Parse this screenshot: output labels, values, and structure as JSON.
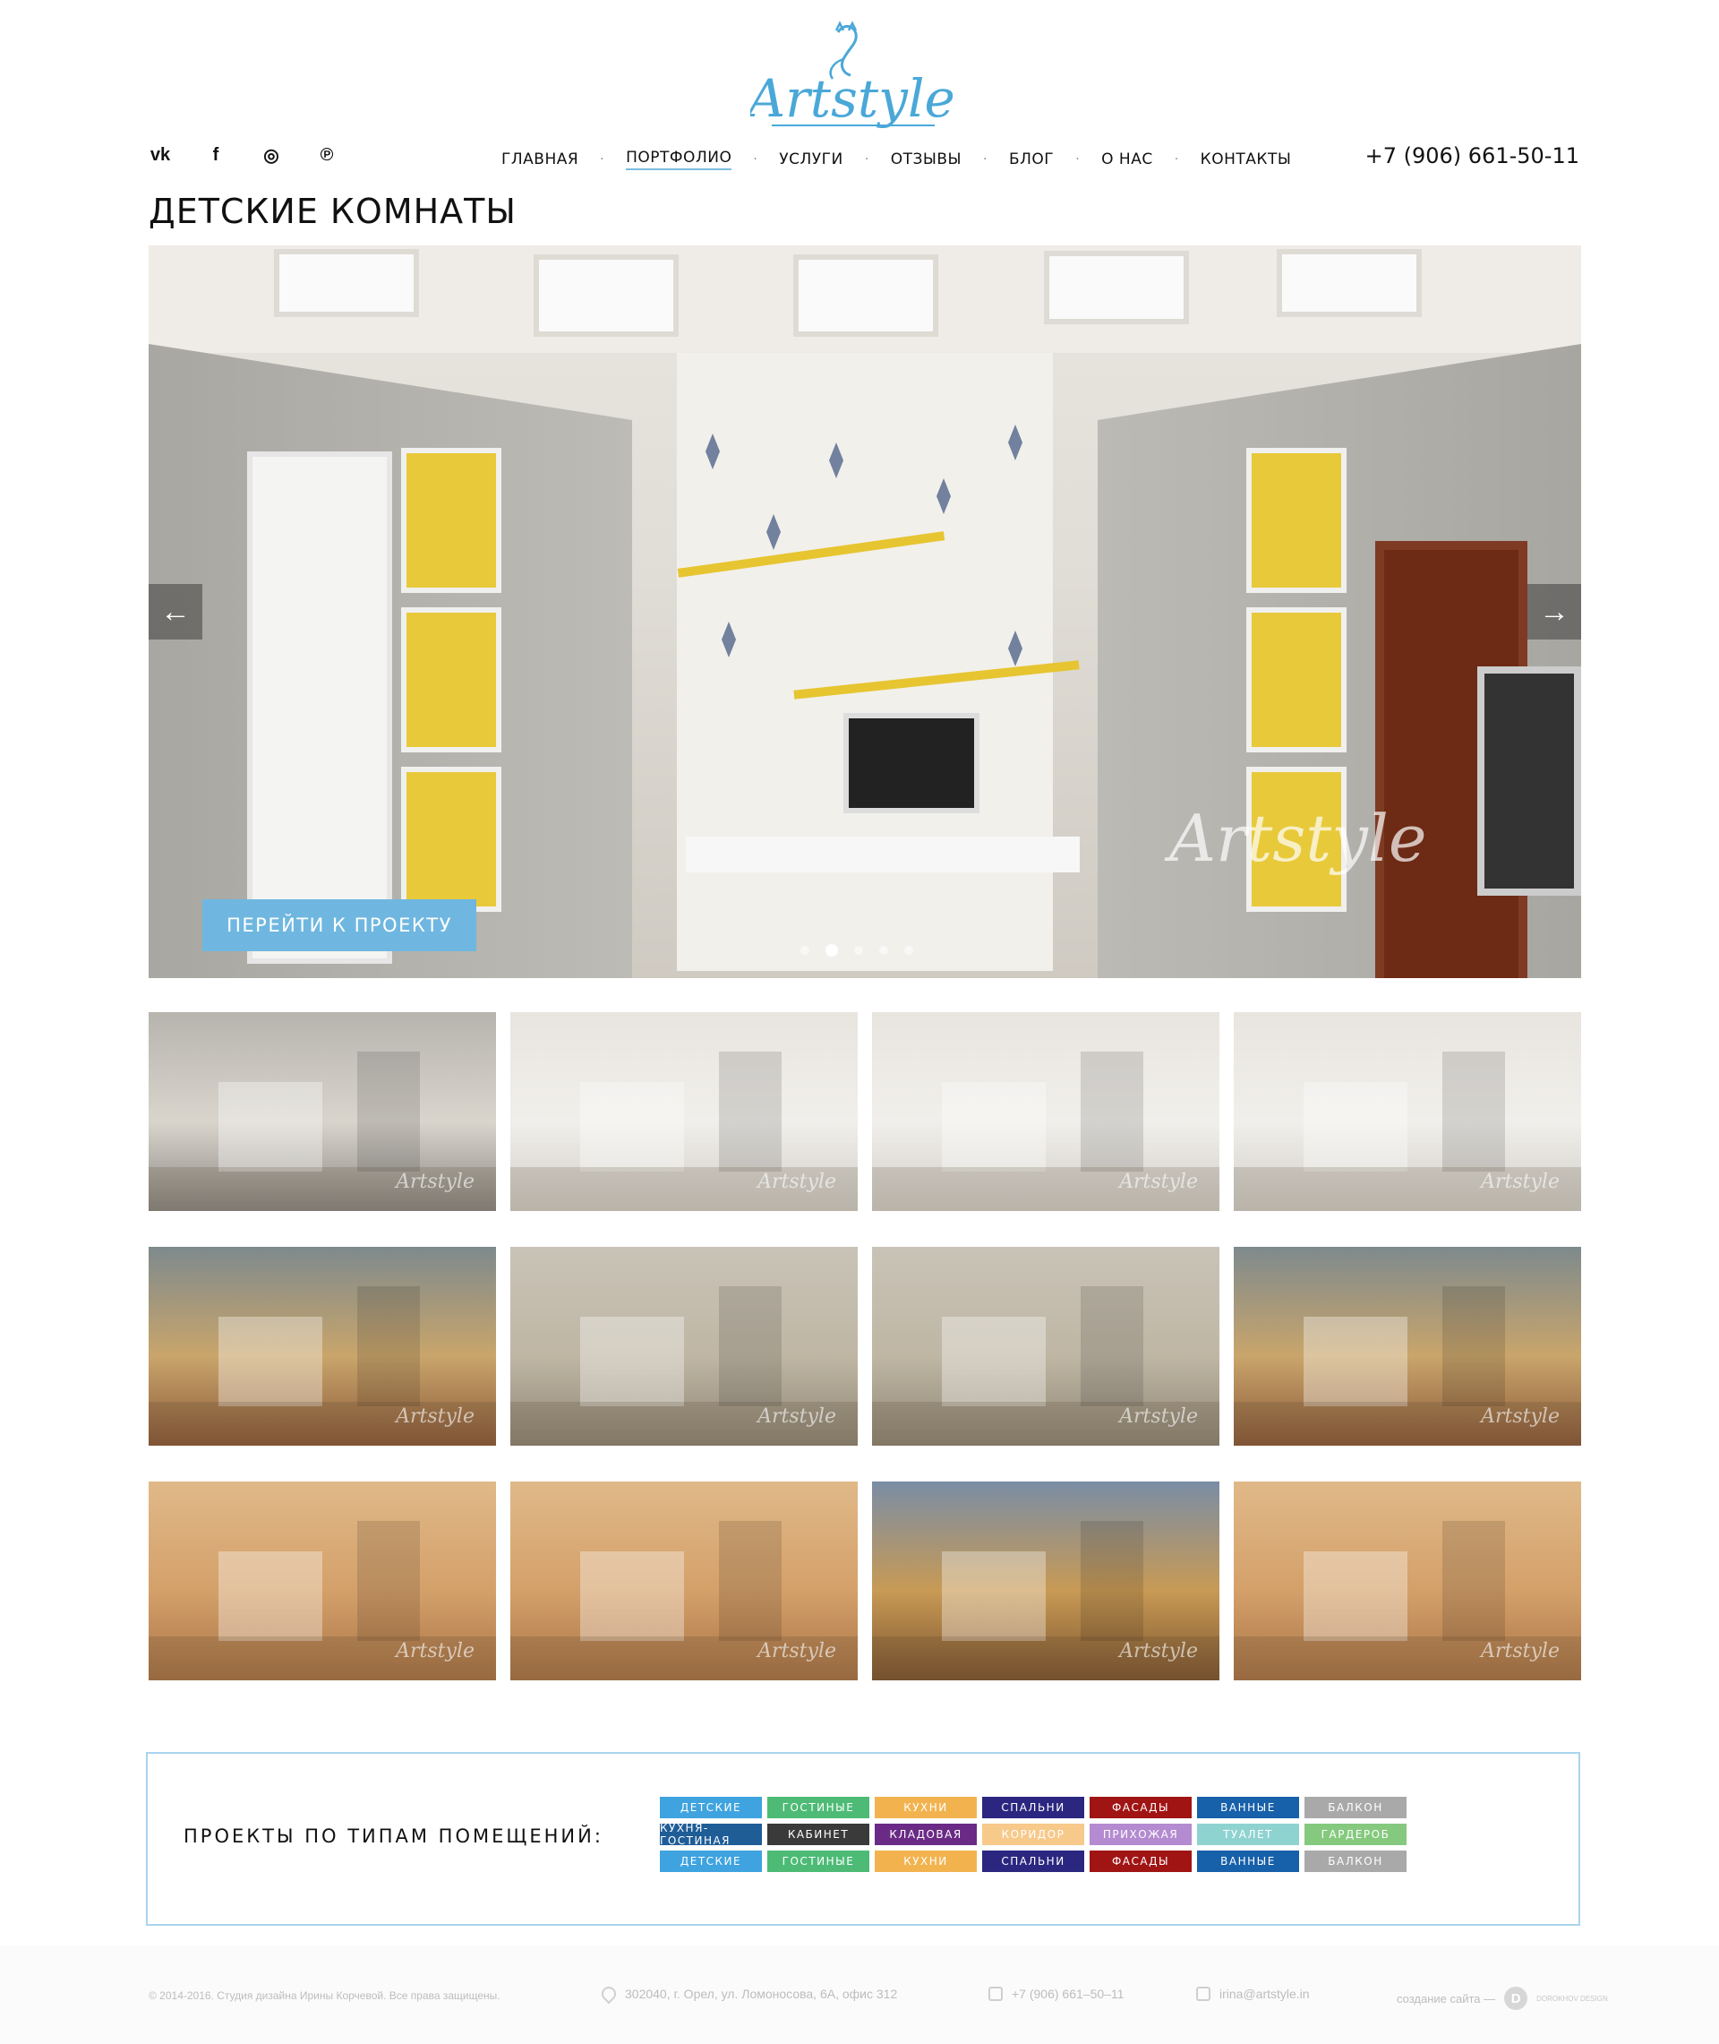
{
  "header": {
    "logo_text": "Artstyle",
    "social": [
      {
        "name": "vk",
        "glyph": "vk"
      },
      {
        "name": "facebook",
        "glyph": "f"
      },
      {
        "name": "instagram",
        "glyph": "◎"
      },
      {
        "name": "pinterest",
        "glyph": "℗"
      }
    ],
    "nav": [
      {
        "label": "Главная",
        "active": false
      },
      {
        "label": "Портфолио",
        "active": true
      },
      {
        "label": "Услуги",
        "active": false
      },
      {
        "label": "Отзывы",
        "active": false
      },
      {
        "label": "Блог",
        "active": false
      },
      {
        "label": "О нас",
        "active": false
      },
      {
        "label": "Контакты",
        "active": false
      }
    ],
    "nav_separator": "·",
    "phone": "+7 (906) 661-50-11"
  },
  "page_title": "ДЕТСКИЕ КОМНАТЫ",
  "slider": {
    "cta_label": "ПЕРЕЙТИ К ПРОЕКТУ",
    "watermark": "Artstyle",
    "prev_glyph": "←",
    "next_glyph": "→",
    "dots_total": 5,
    "active_dot": 2
  },
  "gallery": {
    "watermark": "Artstyle",
    "rows": 3,
    "cols": 4
  },
  "room_types": {
    "label": "ПРОЕКТЫ ПО ТИПАМ ПОМЕЩЕНИЙ:",
    "tags": [
      {
        "label": "Детские",
        "color": "#3fa3e0"
      },
      {
        "label": "Гостиные",
        "color": "#4dbb76"
      },
      {
        "label": "Кухни",
        "color": "#f2b34f"
      },
      {
        "label": "Спальни",
        "color": "#2b2780"
      },
      {
        "label": "Фасады",
        "color": "#a01414"
      },
      {
        "label": "Ванные",
        "color": "#1760aa"
      },
      {
        "label": "Балкон",
        "color": "#a9a9a9"
      },
      {
        "label": "Кухня-гостиная",
        "color": "#1f5d97"
      },
      {
        "label": "Кабинет",
        "color": "#3a3a3a"
      },
      {
        "label": "Кладовая",
        "color": "#6a2a86"
      },
      {
        "label": "Коридор",
        "color": "#f7c98a"
      },
      {
        "label": "Прихожая",
        "color": "#b48ad0"
      },
      {
        "label": "Туалет",
        "color": "#8fd3d1"
      },
      {
        "label": "Гардероб",
        "color": "#85c97e"
      },
      {
        "label": "Детские",
        "color": "#3fa3e0"
      },
      {
        "label": "Гостиные",
        "color": "#4dbb76"
      },
      {
        "label": "Кухни",
        "color": "#f2b34f"
      },
      {
        "label": "Спальни",
        "color": "#2b2780"
      },
      {
        "label": "Фасады",
        "color": "#a01414"
      },
      {
        "label": "Ванные",
        "color": "#1760aa"
      },
      {
        "label": "Балкон",
        "color": "#a9a9a9"
      }
    ]
  },
  "footer": {
    "copyright": "© 2014-2016. Студия дизайна Ирины Корчевой. Все права защищены.",
    "address": "302040, г. Орел, ул. Ломоносова, 6А, офис 312",
    "phone": "+7 (906) 661–50–11",
    "email": "irina@artstyle.in",
    "created_by": "создание сайта —",
    "studio_letter": "D",
    "studio_name": "DOROKHOV DESIGN"
  },
  "colors": {
    "accent": "#6fb7e0",
    "panel_border": "#a9d4ef",
    "logo": "#4aa8d8"
  }
}
